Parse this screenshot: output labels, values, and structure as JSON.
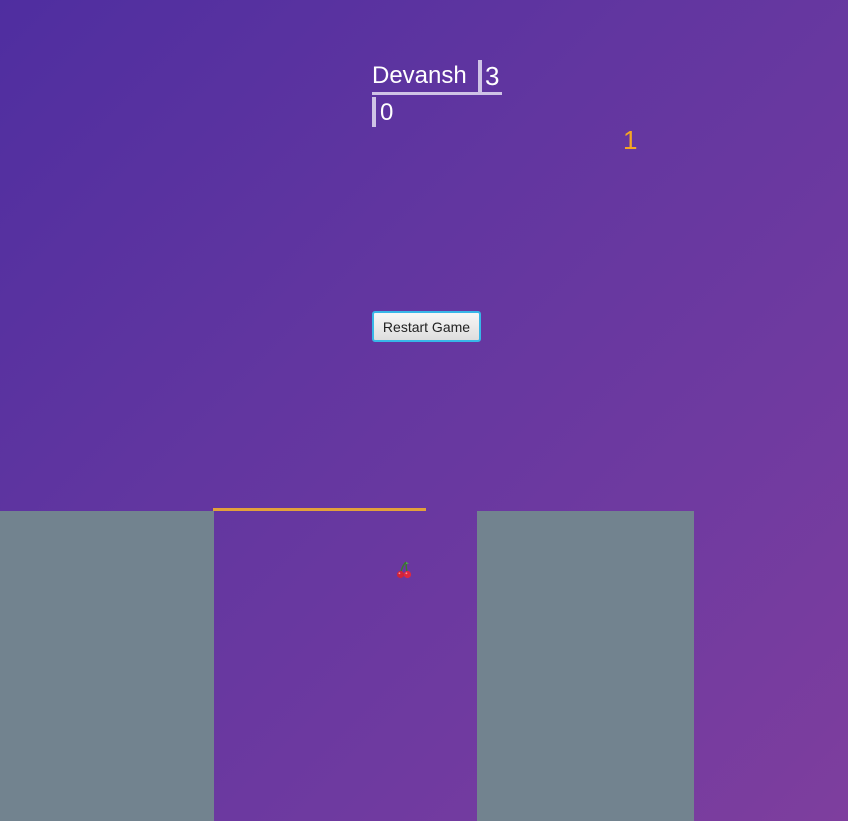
{
  "hud": {
    "player_name": "Devansh",
    "score": "3",
    "cherries": "0",
    "counter": "1"
  },
  "controls": {
    "restart_label": "Restart Game"
  },
  "colors": {
    "background_top_left": "#4f2ea0",
    "background_bottom_right": "#7e3e9e",
    "pillar": "#72838f",
    "stick": "#e3a13a",
    "counter_text": "#f5a623",
    "button_border": "#38b6e8"
  },
  "icons": {
    "collectible": "cherry-icon"
  }
}
